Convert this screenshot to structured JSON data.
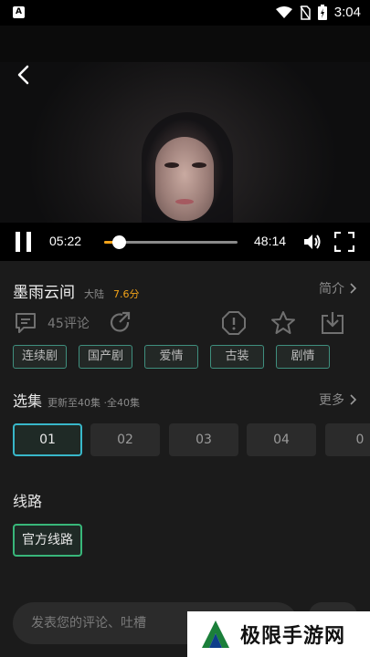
{
  "status_bar": {
    "time": "3:04",
    "icons": [
      "app-icon",
      "wifi-icon",
      "no-sim-icon",
      "battery-charging-icon"
    ]
  },
  "player": {
    "current_time": "05:22",
    "total_time": "48:14",
    "progress": 0.11,
    "accent": "#f3a318"
  },
  "show": {
    "title": "墨雨云间",
    "region": "大陆",
    "rating": "7.6分",
    "intro_label": "简介",
    "comment_count": "45评论",
    "tags": [
      "连续剧",
      "国产剧",
      "爱情",
      "古装",
      "剧情"
    ]
  },
  "episodes": {
    "title": "选集",
    "subtitle": "更新至40集 ·全40集",
    "more_label": "更多",
    "items": [
      "01",
      "02",
      "03",
      "04",
      "0"
    ],
    "active_index": 0
  },
  "route": {
    "title": "线路",
    "options": [
      "官方线路"
    ]
  },
  "comment_bar": {
    "placeholder": "发表您的评论、吐槽"
  },
  "watermark": {
    "text": "极限手游网"
  },
  "colors": {
    "tag_border": "#3f8f7e",
    "episode_active_border": "#38b7c9",
    "route_active_border": "#38b77a",
    "rating": "#f3a318"
  }
}
